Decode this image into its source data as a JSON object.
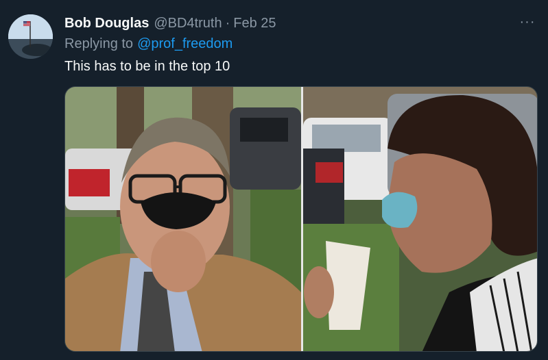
{
  "author": {
    "display_name": "Bob Douglas",
    "handle": "@BD4truth",
    "separator": "·",
    "date": "Feb 25"
  },
  "reply": {
    "prefix": "Replying to",
    "to_handle": "@prof_freedom"
  },
  "tweet": {
    "text": "This has to be in the top 10"
  },
  "menu": {
    "more_label": "···"
  },
  "colors": {
    "background": "#15202b",
    "text_primary": "#f7f9f9",
    "text_secondary": "#8b98a5",
    "link": "#1d9bf0"
  }
}
